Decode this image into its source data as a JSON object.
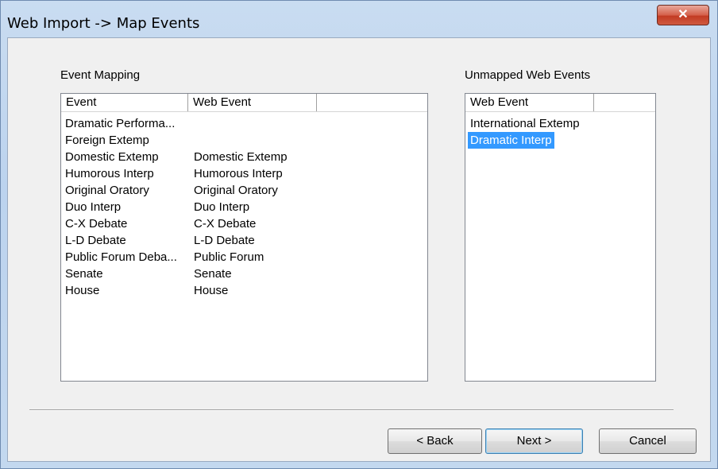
{
  "window": {
    "title": "Web Import -> Map Events",
    "close_glyph": "✕"
  },
  "event_mapping": {
    "label": "Event Mapping",
    "columns": [
      "Event",
      "Web Event",
      ""
    ],
    "rows": [
      {
        "event": "Dramatic Performa...",
        "web_event": ""
      },
      {
        "event": "Foreign Extemp",
        "web_event": ""
      },
      {
        "event": "Domestic Extemp",
        "web_event": "Domestic Extemp"
      },
      {
        "event": "Humorous Interp",
        "web_event": "Humorous Interp"
      },
      {
        "event": "Original Oratory",
        "web_event": "Original Oratory"
      },
      {
        "event": "Duo Interp",
        "web_event": "Duo Interp"
      },
      {
        "event": "C-X Debate",
        "web_event": "C-X Debate"
      },
      {
        "event": "L-D Debate",
        "web_event": "L-D Debate"
      },
      {
        "event": "Public Forum Deba...",
        "web_event": "Public Forum"
      },
      {
        "event": "Senate",
        "web_event": "Senate"
      },
      {
        "event": "House",
        "web_event": "House"
      }
    ]
  },
  "unmapped": {
    "label": "Unmapped Web Events",
    "columns": [
      "Web Event",
      ""
    ],
    "rows": [
      {
        "web_event": "International Extemp",
        "selected": false
      },
      {
        "web_event": "Dramatic Interp",
        "selected": true
      }
    ]
  },
  "buttons": {
    "back": "< Back",
    "next": "Next >",
    "cancel": "Cancel"
  }
}
